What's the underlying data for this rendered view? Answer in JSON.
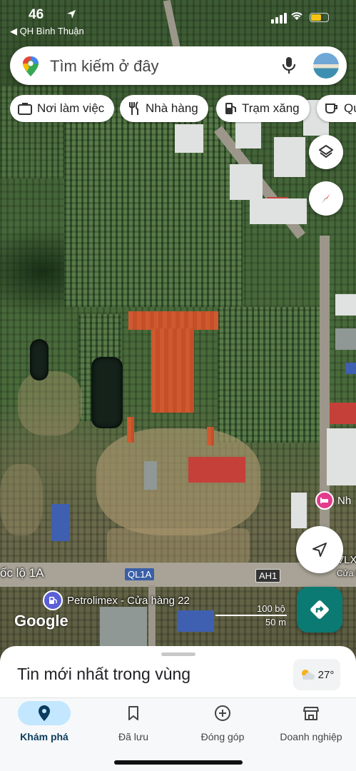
{
  "status_bar": {
    "time": "46",
    "back_label": "◀ QH Bình Thuận"
  },
  "search": {
    "placeholder": "Tìm kiếm ở đây"
  },
  "chips": [
    {
      "label": "Nơi làm việc",
      "icon": "briefcase-icon"
    },
    {
      "label": "Nhà hàng",
      "icon": "restaurant-icon"
    },
    {
      "label": "Trạm xăng",
      "icon": "gas-station-icon"
    },
    {
      "label": "Qu",
      "icon": "coffee-icon"
    }
  ],
  "map": {
    "road_label_main": "ốc lộ 1A",
    "road_shield_ql": "QL1A",
    "road_shield_ah": "AH1",
    "poi_petrolimex": "Petrolimex - Cửa hàng 22",
    "hotel_label": "Nh",
    "right_label_1": "VLX",
    "right_label_2": "Cửa h",
    "google_logo": "Google",
    "scale_feet": "100 bộ",
    "scale_meters": "50 m"
  },
  "sheet": {
    "title": "Tin mới nhất trong vùng",
    "weather_temp": "27°"
  },
  "nav": {
    "items": [
      {
        "label": "Khám phá",
        "icon": "explore-pin-icon",
        "active": true
      },
      {
        "label": "Đã lưu",
        "icon": "bookmark-icon",
        "active": false
      },
      {
        "label": "Đóng góp",
        "icon": "add-circle-icon",
        "active": false
      },
      {
        "label": "Doanh nghiệp",
        "icon": "storefront-icon",
        "active": false
      }
    ]
  },
  "colors": {
    "accent_blue": "#1a73e8",
    "directions_teal": "#0b7a72",
    "active_nav_bg": "#c2e7ff"
  }
}
